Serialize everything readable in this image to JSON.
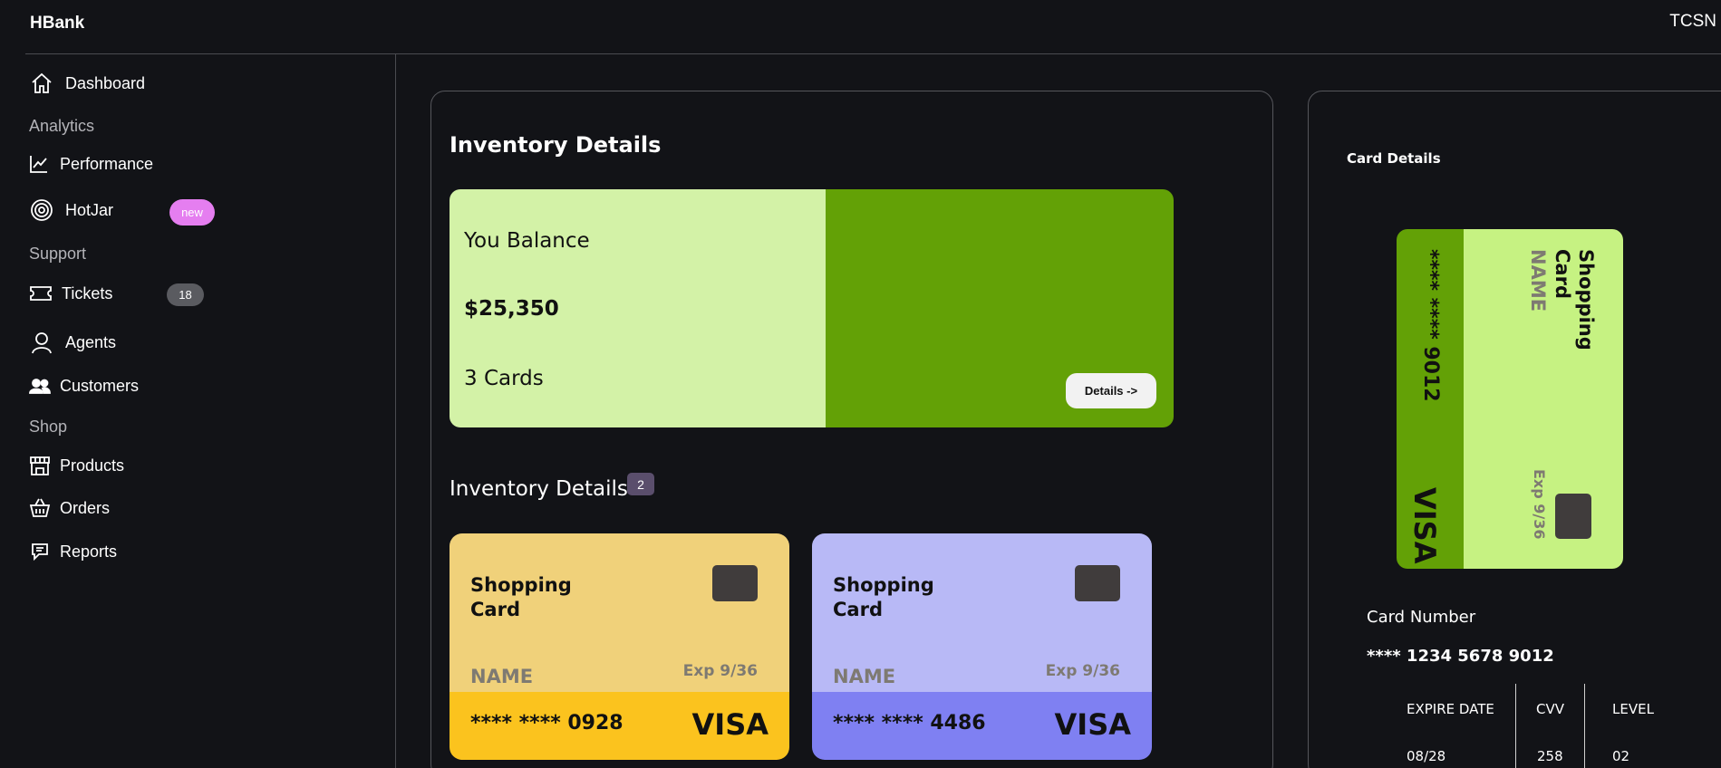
{
  "app": {
    "title": "HBank",
    "user": "TCSN"
  },
  "sidebar": {
    "dashboard": "Dashboard",
    "sections": {
      "analytics": "Analytics",
      "support": "Support",
      "shop": "Shop"
    },
    "performance": "Performance",
    "hotjar": "HotJar",
    "hotjar_badge": "new",
    "tickets": "Tickets",
    "tickets_count": "18",
    "agents": "Agents",
    "customers": "Customers",
    "products": "Products",
    "orders": "Orders",
    "reports": "Reports"
  },
  "main": {
    "title": "Inventory Details",
    "balance": {
      "label": "You Balance",
      "amount": "$25,350",
      "cards": "3 Cards",
      "details_button": "Details ->"
    },
    "inventory_subtitle": "Inventory Details",
    "inventory_count": "2",
    "cards": [
      {
        "title": "Shopping Card",
        "name": "NAME",
        "exp": "Exp 9/36",
        "number": "**** **** 0928",
        "brand": "VISA",
        "top_color": "#f0d17a",
        "bottom_color": "#fbc31e"
      },
      {
        "title": "Shopping Card",
        "name": "NAME",
        "exp": "Exp 9/36",
        "number": "**** **** 4486",
        "brand": "VISA",
        "top_color": "#b8b9f6",
        "bottom_color": "#7f80f2"
      }
    ]
  },
  "card_details": {
    "title": "Card Details",
    "card": {
      "title": "Shopping Card",
      "name": "NAME",
      "exp": "Exp 9/36",
      "number": "**** **** 9012",
      "brand": "VISA"
    },
    "card_number_label": "Card Number",
    "card_number_value": "**** 1234 5678 9012",
    "table": {
      "headers": [
        "EXPIRE DATE",
        "CVV",
        "LEVEL"
      ],
      "values": [
        "08/28",
        "258",
        "02"
      ]
    }
  },
  "colors": {
    "background": "#121317",
    "accent_green": "#63a106",
    "light_green": "#d3f2a7",
    "badge_pink": "#e57ef0"
  }
}
